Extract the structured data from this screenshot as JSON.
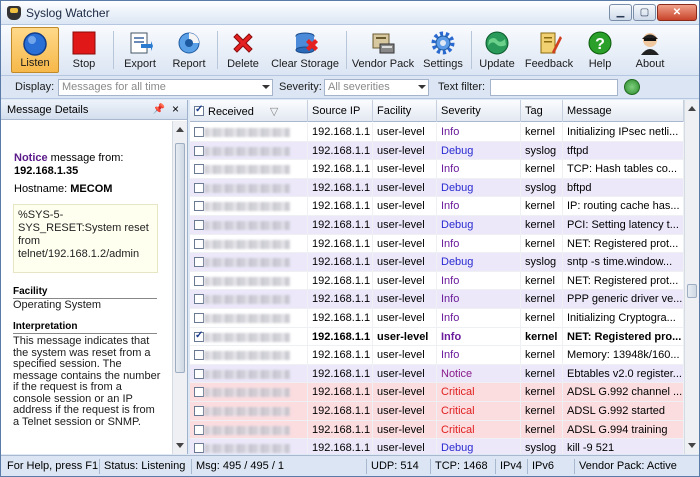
{
  "window": {
    "title": "Syslog Watcher",
    "min": "▁",
    "max": "▢",
    "close": "✕"
  },
  "toolbar": {
    "listen": "Listen",
    "stop": "Stop",
    "export": "Export",
    "report": "Report",
    "delete": "Delete",
    "clear_storage": "Clear Storage",
    "vendor_pack": "Vendor Pack",
    "settings": "Settings",
    "update": "Update",
    "feedback": "Feedback",
    "help": "Help",
    "about": "About"
  },
  "filters": {
    "display_label": "Display:",
    "display_value": "Messages for all time",
    "severity_label": "Severity:",
    "severity_value": "All severities",
    "text_label": "Text filter:",
    "text_value": ""
  },
  "details": {
    "header": "Message Details",
    "severity": "Notice",
    "from_text": " message from:",
    "from_ip": "192.168.1.35",
    "hostname_label": "Hostname:",
    "hostname": "MECOM",
    "message": "%SYS-5-SYS_RESET:System reset from telnet/192.168.1.2/admin",
    "facility_title": "Facility",
    "facility": "Operating System",
    "interpretation_title": "Interpretation",
    "interpretation": "This message indicates that the system was reset from a specified session. The message contains the number if the request is from a console session or an IP address if the request is from a Telnet session or SNMP."
  },
  "grid": {
    "columns": {
      "received": "Received",
      "source_ip": "Source IP",
      "facility": "Facility",
      "severity": "Severity",
      "tag": "Tag",
      "message": "Message"
    },
    "rows": [
      {
        "ip": "192.168.1.1",
        "facility": "user-level",
        "severity": "Info",
        "tag": "kernel",
        "message": "Initializing IPsec netli..."
      },
      {
        "ip": "192.168.1.1",
        "facility": "user-level",
        "severity": "Debug",
        "tag": "syslog",
        "message": "tftpd"
      },
      {
        "ip": "192.168.1.1",
        "facility": "user-level",
        "severity": "Info",
        "tag": "kernel",
        "message": "TCP: Hash tables co..."
      },
      {
        "ip": "192.168.1.1",
        "facility": "user-level",
        "severity": "Debug",
        "tag": "syslog",
        "message": "bftpd"
      },
      {
        "ip": "192.168.1.1",
        "facility": "user-level",
        "severity": "Info",
        "tag": "kernel",
        "message": "IP: routing cache has..."
      },
      {
        "ip": "192.168.1.1",
        "facility": "user-level",
        "severity": "Debug",
        "tag": "kernel",
        "message": "PCI: Setting latency t..."
      },
      {
        "ip": "192.168.1.1",
        "facility": "user-level",
        "severity": "Info",
        "tag": "kernel",
        "message": "NET: Registered prot..."
      },
      {
        "ip": "192.168.1.1",
        "facility": "user-level",
        "severity": "Debug",
        "tag": "syslog",
        "message": "sntp -s time.window..."
      },
      {
        "ip": "192.168.1.1",
        "facility": "user-level",
        "severity": "Info",
        "tag": "kernel",
        "message": "NET: Registered prot..."
      },
      {
        "ip": "192.168.1.1",
        "facility": "user-level",
        "severity": "Info",
        "tag": "kernel",
        "message": "PPP generic driver ve..."
      },
      {
        "ip": "192.168.1.1",
        "facility": "user-level",
        "severity": "Info",
        "tag": "kernel",
        "message": "Initializing Cryptogra..."
      },
      {
        "ip": "192.168.1.1",
        "facility": "user-level",
        "severity": "Info",
        "tag": "kernel",
        "message": "NET: Registered pro..."
      },
      {
        "ip": "192.168.1.1",
        "facility": "user-level",
        "severity": "Info",
        "tag": "kernel",
        "message": "Memory: 13948k/160..."
      },
      {
        "ip": "192.168.1.1",
        "facility": "user-level",
        "severity": "Notice",
        "tag": "kernel",
        "message": "Ebtables v2.0 register..."
      },
      {
        "ip": "192.168.1.1",
        "facility": "user-level",
        "severity": "Critical",
        "tag": "kernel",
        "message": "ADSL G.992 channel ..."
      },
      {
        "ip": "192.168.1.1",
        "facility": "user-level",
        "severity": "Critical",
        "tag": "kernel",
        "message": "ADSL G.992 started"
      },
      {
        "ip": "192.168.1.1",
        "facility": "user-level",
        "severity": "Critical",
        "tag": "kernel",
        "message": "ADSL G.994 training"
      },
      {
        "ip": "192.168.1.1",
        "facility": "user-level",
        "severity": "Debug",
        "tag": "syslog",
        "message": "kill -9 521"
      }
    ]
  },
  "status": {
    "help": "For Help, press F1",
    "state": "Status: Listening",
    "msg": "Msg: 495 / 495 / 1",
    "udp": "UDP: 514",
    "tcp": "TCP: 1468",
    "ipv4": "IPv4",
    "ipv6": "IPv6",
    "vendor": "Vendor Pack: Active"
  }
}
